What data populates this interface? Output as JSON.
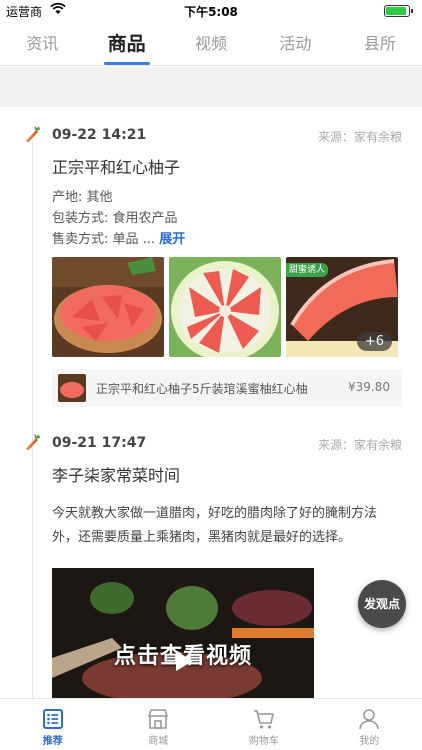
{
  "status_bar": {
    "carrier": "运营商",
    "time": "下午5:08",
    "battery_level": 0.9
  },
  "top_tabs": [
    {
      "label": "资讯",
      "active": false
    },
    {
      "label": "商品",
      "active": true
    },
    {
      "label": "视频",
      "active": false
    },
    {
      "label": "活动",
      "active": false
    },
    {
      "label": "县所",
      "active": false
    }
  ],
  "posts": [
    {
      "date": "09-22 14:21",
      "source": "来源：家有余粮",
      "title": "正宗平和红心柚子",
      "origin": "产地: 其他",
      "packaging": "包装方式: 食用农产品",
      "sale_method": "售卖方式: 单品 ...",
      "expand_label": "展开",
      "photo_tag": "甜蜜诱人",
      "more_count": "+6",
      "product": {
        "name": "正宗平和红心柚子5斤装琯溪蜜柚红心柚",
        "price": "¥39.80"
      }
    },
    {
      "date": "09-21 17:47",
      "source": "来源：家有余粮",
      "title": "李子柒家常菜时间",
      "body": "今天就教大家做一道腊肉，好吃的腊肉除了好的腌制方法外，还需要质量上乘猪肉，黑猪肉就是最好的选择。",
      "video_caption": "点击查看视频"
    }
  ],
  "fab_label": "发观点",
  "bottom_nav": [
    {
      "label": "推荐",
      "icon": "list-icon",
      "active": true
    },
    {
      "label": "商城",
      "icon": "store-icon",
      "active": false
    },
    {
      "label": "购物车",
      "icon": "cart-icon",
      "active": false
    },
    {
      "label": "我的",
      "icon": "person-icon",
      "active": false
    }
  ],
  "colors": {
    "accent": "#2a6fd0",
    "tab_underline": "#3b7de0",
    "carrot": "#e8792a"
  }
}
